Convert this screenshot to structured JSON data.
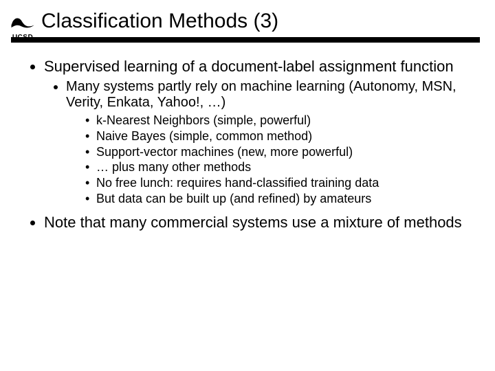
{
  "logo": {
    "label": "UCSD"
  },
  "title": "Classification Methods (3)",
  "bullets": {
    "b1": "Supervised learning of a document-label assignment function",
    "b1_1": "Many systems partly rely on machine learning (Autonomy, MSN, Verity, Enkata, Yahoo!, …)",
    "b1_1_items": [
      "k-Nearest Neighbors (simple, powerful)",
      "Naive Bayes (simple, common method)",
      "Support-vector machines (new, more powerful)",
      "… plus many other methods",
      "No free lunch: requires hand-classified training data",
      "But data can be built up (and refined) by amateurs"
    ],
    "b2": "Note that many commercial systems use a mixture of methods"
  }
}
